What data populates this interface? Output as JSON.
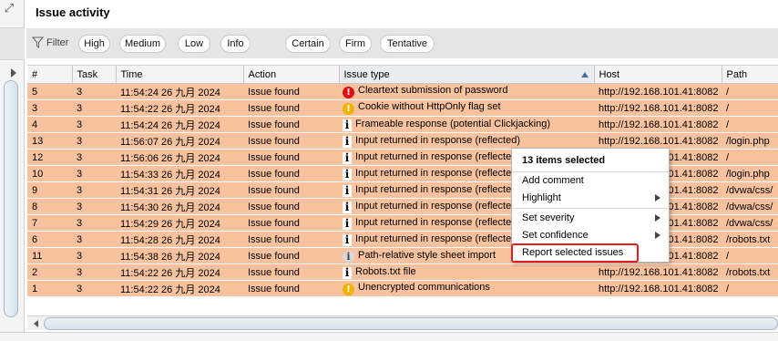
{
  "header": {
    "title": "Issue activity"
  },
  "filter": {
    "label": "Filter",
    "chips": [
      "High",
      "Medium",
      "Low",
      "Info",
      "Certain",
      "Firm",
      "Tentative"
    ]
  },
  "table": {
    "columns": [
      "#",
      "Task",
      "Time",
      "Action",
      "Issue type",
      "Host",
      "Path"
    ],
    "sorted_column": "Issue type",
    "rows": [
      {
        "num": "5",
        "task": "3",
        "time": "11:54:24 26 九月 2024",
        "action": "Issue found",
        "severity": "high",
        "severity_icon": "error-icon",
        "issue": "Cleartext submission of password",
        "host": "http://192.168.101.41:8082",
        "path": "/"
      },
      {
        "num": "3",
        "task": "3",
        "time": "11:54:22 26 九月 2024",
        "action": "Issue found",
        "severity": "low",
        "severity_icon": "warning-icon",
        "issue": "Cookie without HttpOnly flag set",
        "host": "http://192.168.101.41:8082",
        "path": "/"
      },
      {
        "num": "4",
        "task": "3",
        "time": "11:54:24 26 九月 2024",
        "action": "Issue found",
        "severity": "info",
        "severity_icon": "info-icon",
        "issue": "Frameable response (potential Clickjacking)",
        "host": "http://192.168.101.41:8082",
        "path": "/"
      },
      {
        "num": "13",
        "task": "3",
        "time": "11:56:07 26 九月 2024",
        "action": "Issue found",
        "severity": "info",
        "severity_icon": "info-icon",
        "issue": "Input returned in response (reflected)",
        "host": "http://192.168.101.41:8082",
        "path": "/login.php"
      },
      {
        "num": "12",
        "task": "3",
        "time": "11:56:06 26 九月 2024",
        "action": "Issue found",
        "severity": "info",
        "severity_icon": "info-icon",
        "issue": "Input returned in response (reflected)",
        "host": "http://192.168.101.41:8082",
        "path": "/"
      },
      {
        "num": "10",
        "task": "3",
        "time": "11:54:33 26 九月 2024",
        "action": "Issue found",
        "severity": "info",
        "severity_icon": "info-icon",
        "issue": "Input returned in response (reflected)",
        "host": "http://192.168.101.41:8082",
        "path": "/login.php"
      },
      {
        "num": "9",
        "task": "3",
        "time": "11:54:31 26 九月 2024",
        "action": "Issue found",
        "severity": "info",
        "severity_icon": "info-icon",
        "issue": "Input returned in response (reflected)",
        "host": "http://192.168.101.41:8082",
        "path": "/dvwa/css/"
      },
      {
        "num": "8",
        "task": "3",
        "time": "11:54:30 26 九月 2024",
        "action": "Issue found",
        "severity": "info",
        "severity_icon": "info-icon",
        "issue": "Input returned in response (reflected)",
        "host": "http://192.168.101.41:8082",
        "path": "/dvwa/css/"
      },
      {
        "num": "7",
        "task": "3",
        "time": "11:54:29 26 九月 2024",
        "action": "Issue found",
        "severity": "info",
        "severity_icon": "info-icon",
        "issue": "Input returned in response (reflected)",
        "host": "http://192.168.101.41:8082",
        "path": "/dvwa/css/"
      },
      {
        "num": "6",
        "task": "3",
        "time": "11:54:28 26 九月 2024",
        "action": "Issue found",
        "severity": "info",
        "severity_icon": "info-icon",
        "issue": "Input returned in response (reflected)",
        "host": "http://192.168.101.41:8082",
        "path": "/robots.txt"
      },
      {
        "num": "11",
        "task": "3",
        "time": "11:54:38 26 九月 2024",
        "action": "Issue found",
        "severity": "infogray",
        "severity_icon": "info-gray-icon",
        "issue": "Path-relative style sheet import",
        "host": "http://192.168.101.41:8082",
        "path": "/"
      },
      {
        "num": "2",
        "task": "3",
        "time": "11:54:22 26 九月 2024",
        "action": "Issue found",
        "severity": "info",
        "severity_icon": "info-icon",
        "issue": "Robots.txt file",
        "host": "http://192.168.101.41:8082",
        "path": "/robots.txt"
      },
      {
        "num": "1",
        "task": "3",
        "time": "11:54:22 26 九月 2024",
        "action": "Issue found",
        "severity": "low",
        "severity_icon": "warning-icon",
        "issue": "Unencrypted communications",
        "host": "http://192.168.101.41:8082",
        "path": "/"
      }
    ]
  },
  "context_menu": {
    "header": "13 items selected",
    "items": [
      "Add comment",
      "Highlight",
      "Set severity",
      "Set confidence",
      "Report selected issues"
    ]
  },
  "colors": {
    "row_selected": "#f8c29e",
    "severity_high": "#e01010",
    "severity_low": "#f0b400",
    "highlight_box": "#e02020"
  }
}
